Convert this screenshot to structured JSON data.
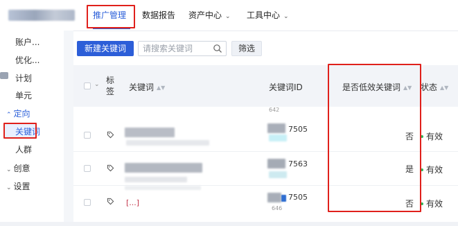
{
  "topnav": {
    "items": [
      {
        "label": "推广管理",
        "active": true
      },
      {
        "label": "数据报告"
      },
      {
        "label": "资产中心",
        "has_dropdown": true
      },
      {
        "label": "工具中心",
        "has_dropdown": true
      }
    ]
  },
  "sidebar": {
    "items": [
      {
        "label": "账户..."
      },
      {
        "label": "优化..."
      },
      {
        "label": "计划"
      },
      {
        "label": "单元"
      },
      {
        "label": "定向",
        "group": true,
        "expanded": true
      },
      {
        "label": "关键词",
        "active": true
      },
      {
        "label": "人群"
      },
      {
        "label": "创意",
        "group": true,
        "expanded": false
      },
      {
        "label": "设置",
        "group": true,
        "expanded": false
      }
    ]
  },
  "toolbar": {
    "new_keyword_label": "新建关键词",
    "search_placeholder": "请搜索关键词",
    "filter_label": "筛选"
  },
  "table": {
    "columns": {
      "tag": "标签",
      "keyword": "关键词",
      "keyword_id": "关键词ID",
      "low_efficiency": "是否低效关键词",
      "status": "状态"
    },
    "clipped_above_id": "642",
    "rows": [
      {
        "keyword_id_suffix": "7505",
        "low_efficiency": "否",
        "status": "有效"
      },
      {
        "keyword_id_suffix": "7563",
        "low_efficiency": "是",
        "status": "有效"
      },
      {
        "keyword_id_suffix": "7505",
        "low_efficiency": "否",
        "status": "有效",
        "keyword_partial": "[...]",
        "id_below": "646"
      }
    ]
  },
  "colors": {
    "primary": "#2c5ed8",
    "highlight_box": "#e0201b",
    "status_ok": "#2fb45a"
  },
  "icons": {
    "search": "search-icon",
    "tag": "tag-icon",
    "chevron": "chevron-down-icon"
  }
}
